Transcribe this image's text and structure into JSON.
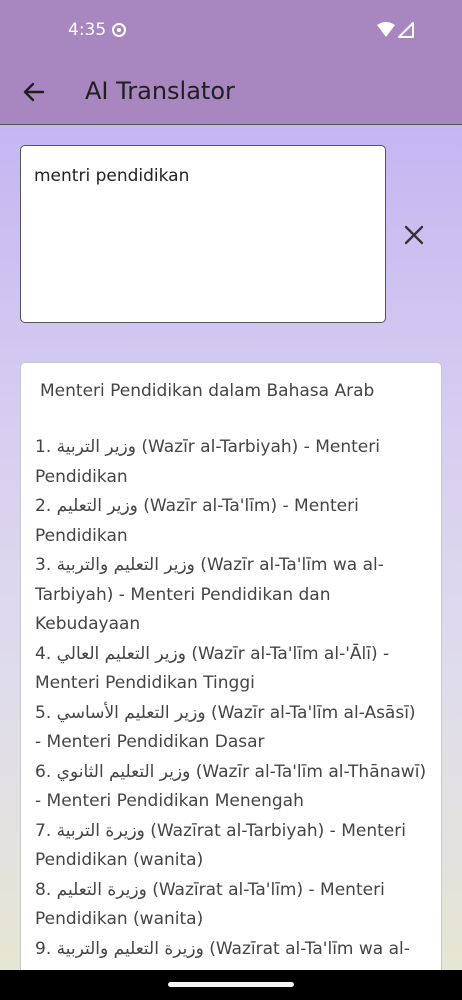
{
  "status_bar": {
    "time": "4:35"
  },
  "app_bar": {
    "title": "AI Translator"
  },
  "input": {
    "value": "mentri pendidikan"
  },
  "result": {
    "heading": "Menteri Pendidikan dalam Bahasa Arab",
    "items": [
      {
        "num": "1.",
        "arabic": "وزير التربية",
        "text": " (Wazīr al-Tarbiyah) - Menteri Pendidikan"
      },
      {
        "num": "2.",
        "arabic": "وزير التعليم",
        "text": " (Wazīr al-Ta'līm) - Menteri Pendidikan"
      },
      {
        "num": "3.",
        "arabic": "وزير التعليم والتربية",
        "text": " (Wazīr al-Ta'līm wa al-Tarbiyah) - Menteri Pendidikan dan Kebudayaan"
      },
      {
        "num": "4.",
        "arabic": "وزير التعليم العالي",
        "text": " (Wazīr al-Ta'līm al-'Ālī) - Menteri Pendidikan Tinggi"
      },
      {
        "num": "5.",
        "arabic": "وزير التعليم الأساسي",
        "text": " (Wazīr al-Ta'līm al-Asāsī) - Menteri Pendidikan Dasar"
      },
      {
        "num": "6.",
        "arabic": "وزير التعليم الثانوي",
        "text": " (Wazīr al-Ta'līm al-Thānawī) - Menteri Pendidikan Menengah"
      },
      {
        "num": "7.",
        "arabic": "وزيرة التربية",
        "text": " (Wazīrat al-Tarbiyah) - Menteri Pendidikan (wanita)"
      },
      {
        "num": "8.",
        "arabic": "وزيرة التعليم",
        "text": " (Wazīrat al-Ta'līm) - Menteri Pendidikan (wanita)"
      },
      {
        "num": "9.",
        "arabic": "وزيرة التعليم والتربية",
        "text": " (Wazīrat al-Ta'līm wa al-"
      }
    ]
  }
}
